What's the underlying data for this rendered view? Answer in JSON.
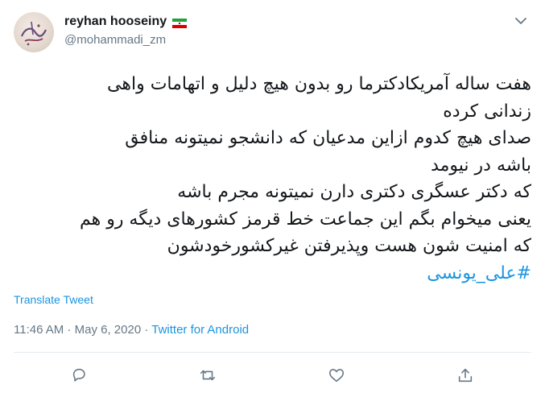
{
  "author": {
    "display_name": "reyhan hooseiny",
    "handle": "@mohammadi_zm",
    "avatar_icon": "avatar-calligraphy",
    "flag_icon": "iran-flag-icon"
  },
  "menu": {
    "icon": "chevron-down-icon"
  },
  "tweet": {
    "lines": [
      "هفت ساله آمریکادکترما رو بدون هیچ دلیل و اتهامات واهی",
      "زندانی کرده",
      "صدای هیچ کدوم ازاین مدعیان که دانشجو نمیتونه منافق",
      "باشه در نیومد",
      "که دکتر عسگری دکتری دارن نمیتونه مجرم باشه",
      "یعنی میخوام بگم این جماعت خط قرمز کشورهای دیگه رو هم",
      "که امنیت شون هست وپذیرفتن غیرکشورخودشون"
    ],
    "hashtag": "#علی_یونسی",
    "translate_label": "Translate Tweet"
  },
  "meta": {
    "time": "11:46 AM",
    "separator1": " · ",
    "date": "May 6, 2020",
    "separator2": " · ",
    "source": "Twitter for Android"
  },
  "actions": [
    {
      "name": "reply",
      "icon": "reply-icon"
    },
    {
      "name": "retweet",
      "icon": "retweet-icon"
    },
    {
      "name": "like",
      "icon": "heart-icon"
    },
    {
      "name": "share",
      "icon": "share-icon"
    }
  ],
  "colors": {
    "text": "#14171a",
    "secondary": "#657786",
    "link": "#1b95e0",
    "divider": "#e6ecf0",
    "icon": "#657786"
  }
}
